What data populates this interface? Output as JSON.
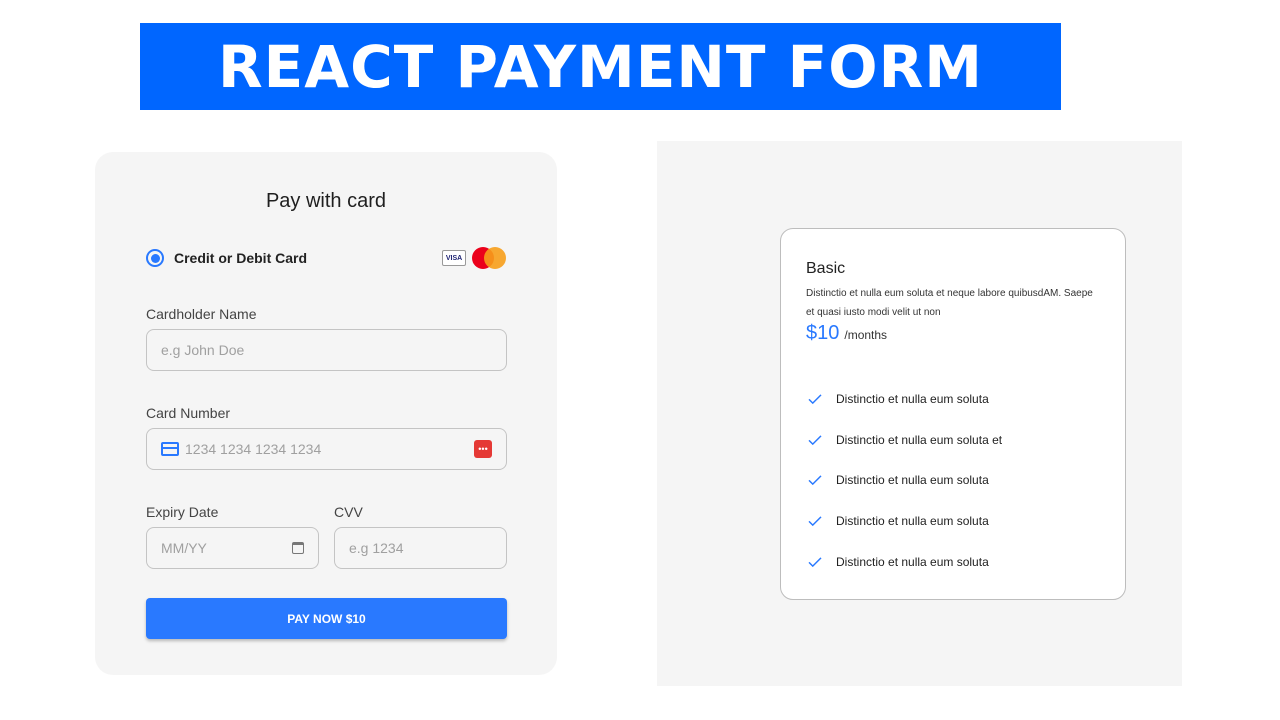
{
  "banner": {
    "title": "REACT PAYMENT FORM"
  },
  "payment_form": {
    "title": "Pay with card",
    "method_label": "Credit or Debit Card",
    "brand_visa": "VISA",
    "cardholder": {
      "label": "Cardholder Name",
      "placeholder": "e.g John Doe"
    },
    "card_number": {
      "label": "Card Number",
      "placeholder": "1234 1234 1234 1234"
    },
    "expiry": {
      "label": "Expiry Date",
      "placeholder": "MM/YY"
    },
    "cvv": {
      "label": "CVV",
      "placeholder": "e.g 1234"
    },
    "submit_label": "PAY NOW $10"
  },
  "plan_card": {
    "name": "Basic",
    "description": "Distinctio et nulla eum soluta et neque labore quibusdAM. Saepe et quasi iusto modi velit ut non",
    "price": "$10",
    "period": "/months",
    "features": [
      "Distinctio et nulla eum soluta",
      "Distinctio et nulla eum soluta et",
      "Distinctio et nulla eum soluta",
      "Distinctio et nulla eum soluta",
      "Distinctio et nulla eum soluta"
    ]
  },
  "colors": {
    "accent": "#2979ff",
    "banner": "#0066ff",
    "panel": "#f5f5f5"
  }
}
